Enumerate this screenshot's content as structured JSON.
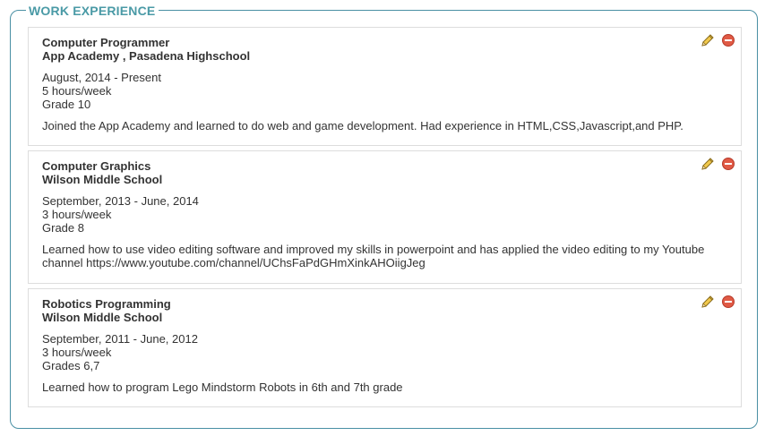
{
  "section": {
    "legend": "WORK EXPERIENCE"
  },
  "colors": {
    "accent": "#4a9aa6",
    "border": "#dddddd",
    "delete": "#e05a45",
    "edit": "#e2b43a"
  },
  "entries": [
    {
      "title": "Computer Programmer",
      "organization": "App Academy , Pasadena Highschool",
      "dates": "August, 2014 - Present",
      "hours": "5 hours/week",
      "grade": "Grade 10",
      "description": "Joined the App Academy and learned to do web and game development. Had experience in HTML,CSS,Javascript,and PHP.",
      "edit_icon": "pencil-icon",
      "delete_icon": "minus-circle-icon"
    },
    {
      "title": "Computer Graphics",
      "organization": "Wilson Middle School",
      "dates": "September, 2013 - June, 2014",
      "hours": "3 hours/week",
      "grade": "Grade 8",
      "description": "Learned how to use video editing software and improved my skills in powerpoint and has applied the video editing to my Youtube channel https://www.youtube.com/channel/UChsFaPdGHmXinkAHOiigJeg",
      "edit_icon": "pencil-icon",
      "delete_icon": "minus-circle-icon"
    },
    {
      "title": "Robotics Programming",
      "organization": "Wilson Middle School",
      "dates": "September, 2011 - June, 2012",
      "hours": "3 hours/week",
      "grade": "Grades 6,7",
      "description": "Learned how to program Lego Mindstorm Robots in 6th and 7th grade",
      "edit_icon": "pencil-icon",
      "delete_icon": "minus-circle-icon"
    }
  ]
}
